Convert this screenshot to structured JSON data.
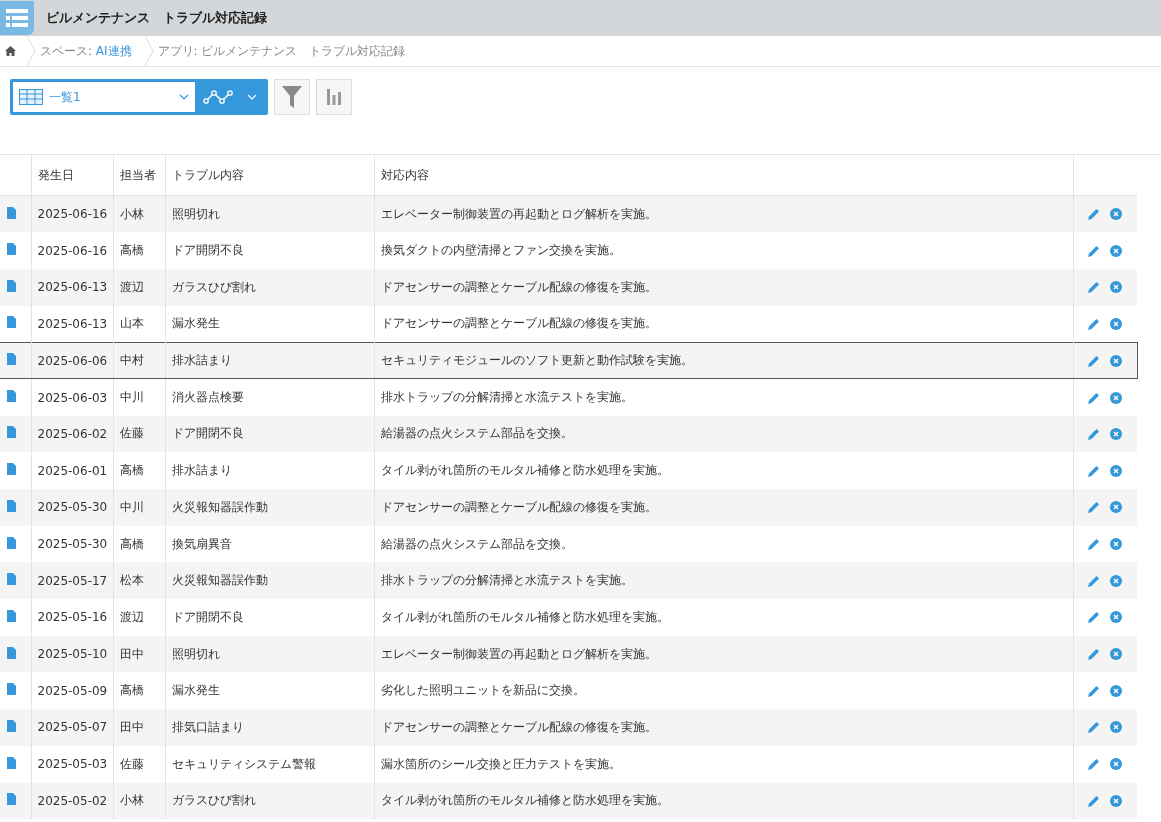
{
  "header": {
    "title": "ビルメンテナンス　トラブル対応記録"
  },
  "breadcrumb": [
    {
      "label": "スペース: ",
      "link": "AI連携"
    },
    {
      "label": "アプリ: ビルメンテナンス　トラブル対応記録"
    }
  ],
  "toolbar": {
    "view": "一覧1"
  },
  "table": {
    "columns": [
      "発生日",
      "担当者",
      "トラブル内容",
      "対応内容"
    ],
    "rows": [
      {
        "date": "2025-06-16",
        "person": "小林",
        "trouble": "照明切れ",
        "response": "エレベーター制御装置の再起動とログ解析を実施。",
        "selected": false
      },
      {
        "date": "2025-06-16",
        "person": "高橋",
        "trouble": "ドア開閉不良",
        "response": "換気ダクトの内壁清掃とファン交換を実施。",
        "selected": false
      },
      {
        "date": "2025-06-13",
        "person": "渡辺",
        "trouble": "ガラスひび割れ",
        "response": "ドアセンサーの調整とケーブル配線の修復を実施。",
        "selected": false
      },
      {
        "date": "2025-06-13",
        "person": "山本",
        "trouble": "漏水発生",
        "response": "ドアセンサーの調整とケーブル配線の修復を実施。",
        "selected": false
      },
      {
        "date": "2025-06-06",
        "person": "中村",
        "trouble": "排水詰まり",
        "response": "セキュリティモジュールのソフト更新と動作試験を実施。",
        "selected": true
      },
      {
        "date": "2025-06-03",
        "person": "中川",
        "trouble": "消火器点検要",
        "response": "排水トラップの分解清掃と水流テストを実施。",
        "selected": false
      },
      {
        "date": "2025-06-02",
        "person": "佐藤",
        "trouble": "ドア開閉不良",
        "response": "給湯器の点火システム部品を交換。",
        "selected": false
      },
      {
        "date": "2025-06-01",
        "person": "高橋",
        "trouble": "排水詰まり",
        "response": "タイル剥がれ箇所のモルタル補修と防水処理を実施。",
        "selected": false
      },
      {
        "date": "2025-05-30",
        "person": "中川",
        "trouble": "火災報知器誤作動",
        "response": "ドアセンサーの調整とケーブル配線の修復を実施。",
        "selected": false
      },
      {
        "date": "2025-05-30",
        "person": "高橋",
        "trouble": "換気扇異音",
        "response": "給湯器の点火システム部品を交換。",
        "selected": false
      },
      {
        "date": "2025-05-17",
        "person": "松本",
        "trouble": "火災報知器誤作動",
        "response": "排水トラップの分解清掃と水流テストを実施。",
        "selected": false
      },
      {
        "date": "2025-05-16",
        "person": "渡辺",
        "trouble": "ドア開閉不良",
        "response": "タイル剥がれ箇所のモルタル補修と防水処理を実施。",
        "selected": false
      },
      {
        "date": "2025-05-10",
        "person": "田中",
        "trouble": "照明切れ",
        "response": "エレベーター制御装置の再起動とログ解析を実施。",
        "selected": false
      },
      {
        "date": "2025-05-09",
        "person": "高橋",
        "trouble": "漏水発生",
        "response": "劣化した照明ユニットを新品に交換。",
        "selected": false
      },
      {
        "date": "2025-05-07",
        "person": "田中",
        "trouble": "排気口詰まり",
        "response": "ドアセンサーの調整とケーブル配線の修復を実施。",
        "selected": false
      },
      {
        "date": "2025-05-03",
        "person": "佐藤",
        "trouble": "セキュリティシステム警報",
        "response": "漏水箇所のシール交換と圧力テストを実施。",
        "selected": false
      },
      {
        "date": "2025-05-02",
        "person": "小林",
        "trouble": "ガラスひび割れ",
        "response": "タイル剥がれ箇所のモルタル補修と防水処理を実施。",
        "selected": false
      }
    ]
  }
}
